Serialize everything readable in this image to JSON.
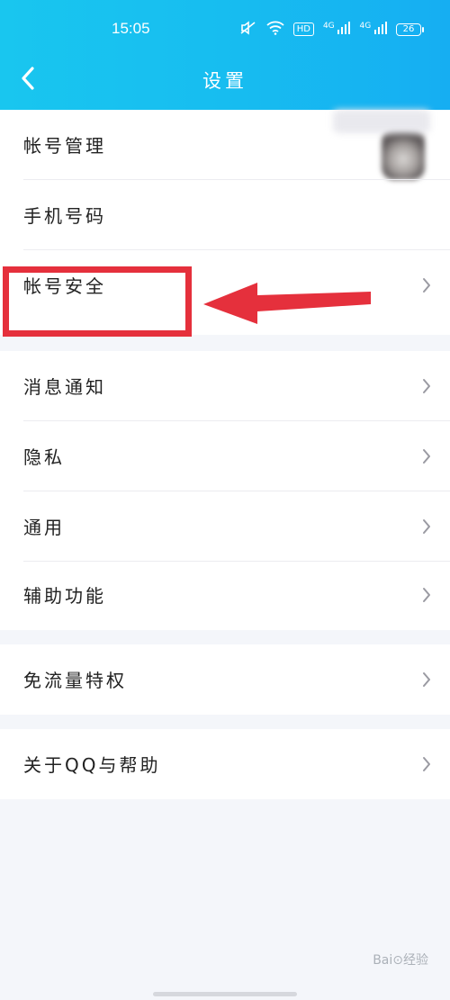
{
  "status_bar": {
    "time": "15:05",
    "icons": [
      "mute-icon",
      "wifi-icon",
      "hd-icon",
      "signal-4g-icon",
      "signal-4g-icon",
      "battery-icon"
    ],
    "hd_label": "HD",
    "signal_label": "4G",
    "battery_level": "26"
  },
  "nav": {
    "title": "设置"
  },
  "groups": [
    {
      "items": [
        {
          "label": "帐号管理"
        },
        {
          "label": "手机号码"
        },
        {
          "label": "帐号安全"
        }
      ]
    },
    {
      "items": [
        {
          "label": "消息通知"
        },
        {
          "label": "隐私"
        },
        {
          "label": "通用"
        },
        {
          "label": "辅助功能"
        }
      ]
    },
    {
      "items": [
        {
          "label": "免流量特权"
        }
      ]
    },
    {
      "items": [
        {
          "label": "关于QQ与帮助"
        }
      ]
    }
  ],
  "annotation": {
    "highlight_color": "#e5303c"
  },
  "watermark": {
    "text": "Bai⊙经验"
  },
  "colors": {
    "header_start": "#19c6ef",
    "header_end": "#16aef2",
    "background": "#f4f6fa"
  }
}
